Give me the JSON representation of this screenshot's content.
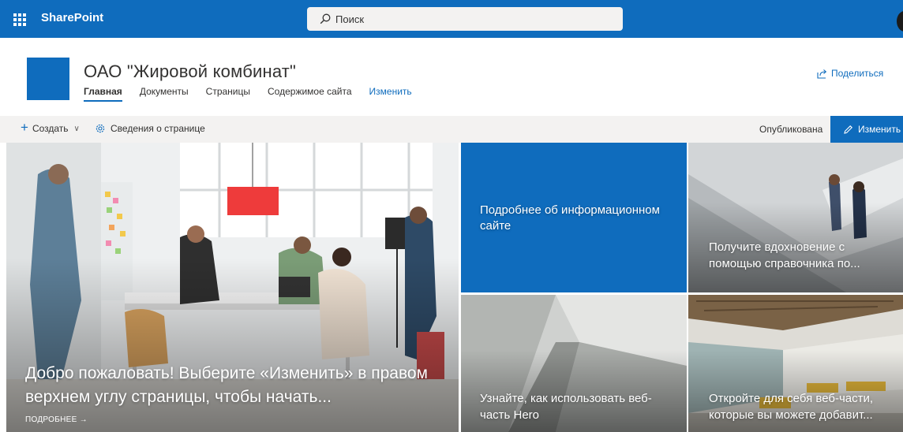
{
  "suite": {
    "app_name": "SharePoint",
    "search_placeholder": "Поиск",
    "icons": {
      "launcher": "app-launcher-icon",
      "search": "search-icon"
    },
    "bar_color": "#0f6cbd"
  },
  "site": {
    "title": "ОАО \"Жировой комбинат\"",
    "nav": [
      {
        "label": "Главная",
        "active": true
      },
      {
        "label": "Документы"
      },
      {
        "label": "Страницы"
      },
      {
        "label": "Содержимое сайта"
      },
      {
        "label": "Изменить"
      }
    ],
    "share_label": "Поделиться",
    "icons": {
      "share": "share-icon"
    }
  },
  "command_bar": {
    "new_label": "Создать",
    "page_details_label": "Сведения о странице",
    "status": "Опубликована",
    "edit_label": "Изменить",
    "icons": {
      "new": "plus-icon",
      "dropdown": "chevron-down-icon",
      "details": "gear-icon",
      "edit": "pencil-icon"
    },
    "edit_color": "#0f6cbd"
  },
  "hero": {
    "main": {
      "caption": "Добро пожаловать! Выберите «Изменить» в правом верхнем углу страницы, чтобы начать...",
      "more_label": "ПОДРОБНЕЕ"
    },
    "tiles": [
      {
        "caption": "Подробнее об информационном сайте"
      },
      {
        "caption": "Получите вдохновение с помощью справочника по..."
      },
      {
        "caption": "Узнайте, как использовать веб-часть Hero"
      },
      {
        "caption": "Откройте для себя веб-части, которые вы можете добавит..."
      }
    ]
  }
}
